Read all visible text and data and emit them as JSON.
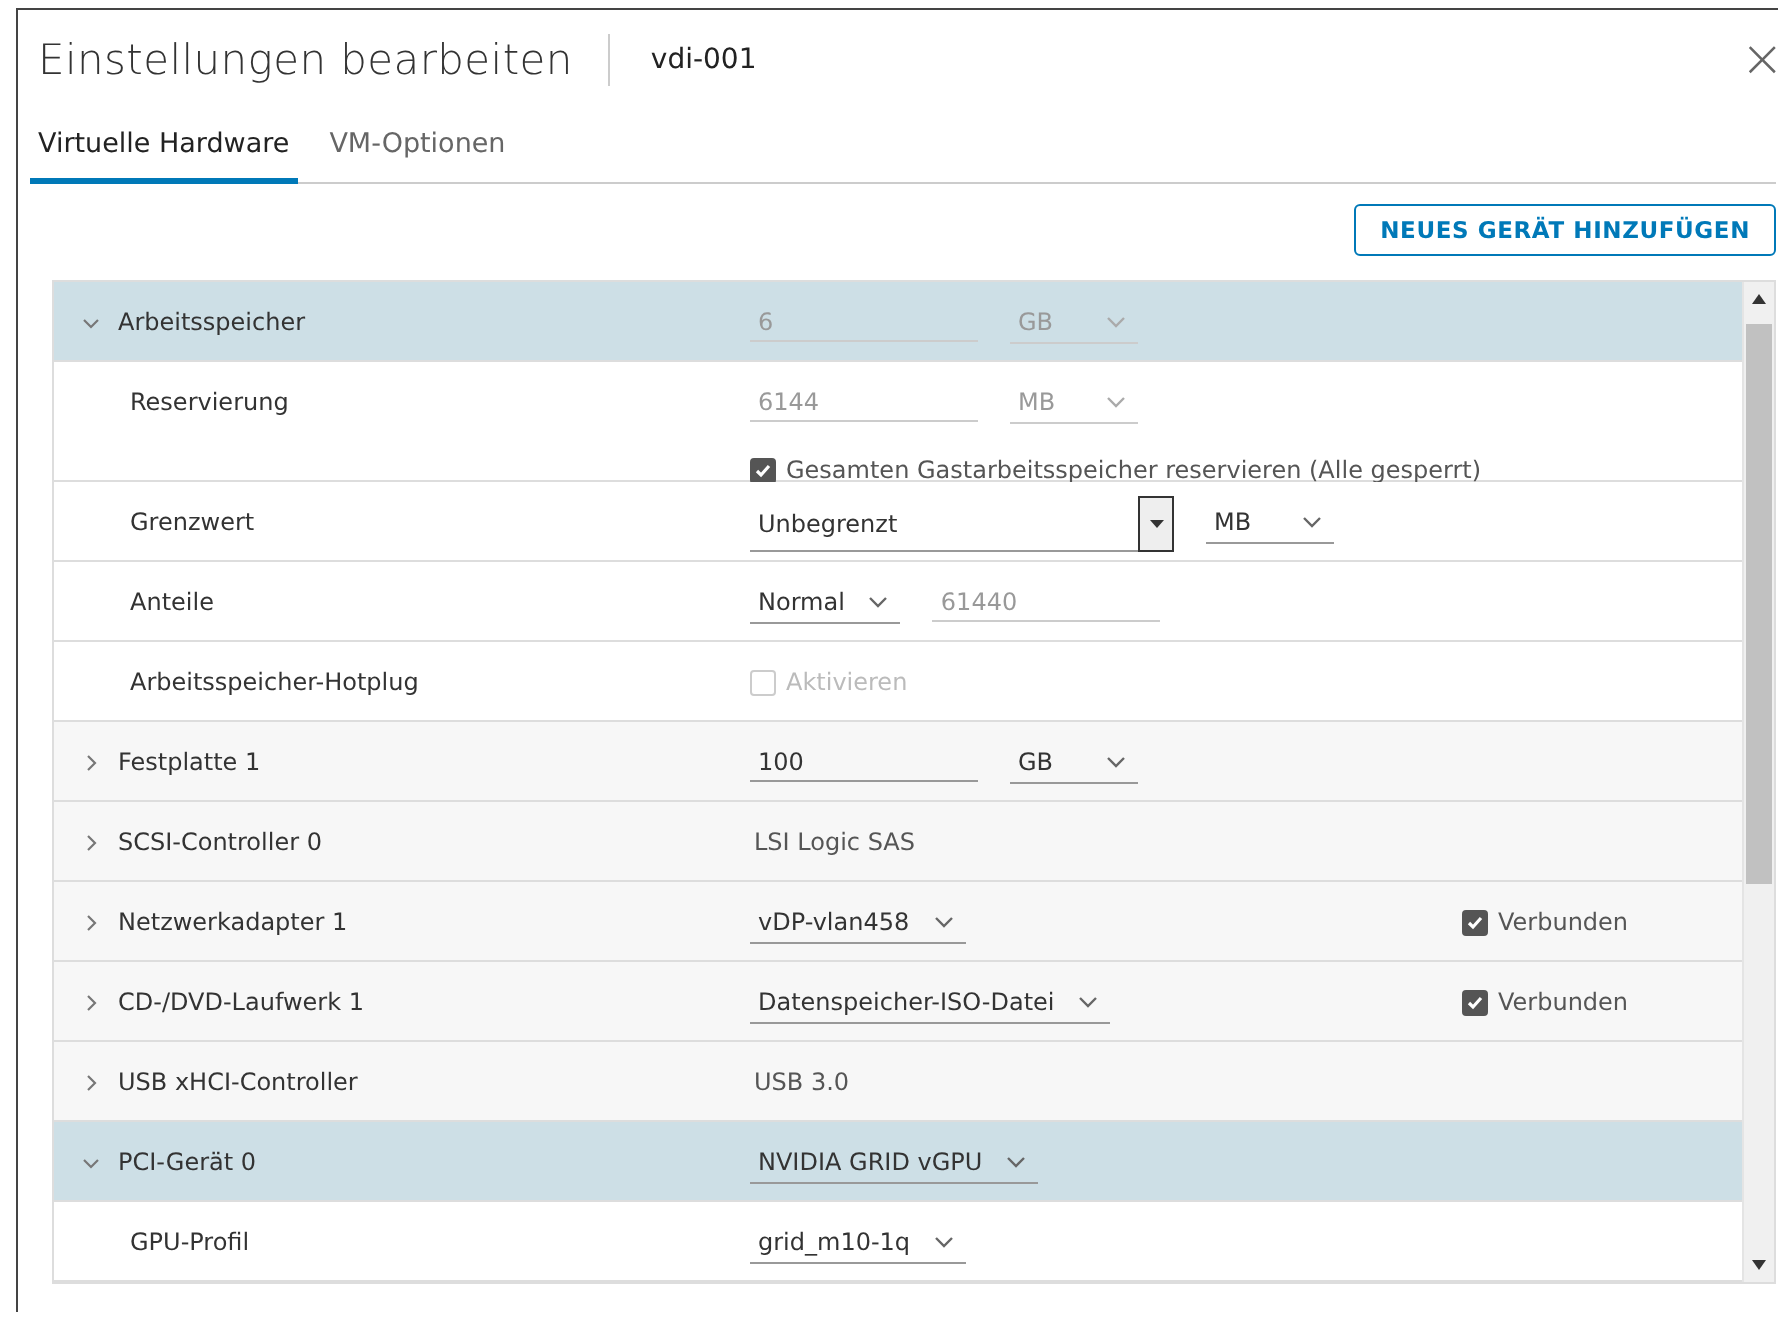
{
  "dialog": {
    "title": "Einstellungen bearbeiten",
    "subtitle": "vdi-001",
    "close": "×"
  },
  "tabs": [
    {
      "label": "Virtuelle Hardware",
      "selected": true
    },
    {
      "label": "VM-Optionen",
      "selected": false
    }
  ],
  "add_button": "NEUES GERÄT HINZUFÜGEN",
  "rows": [
    {
      "kind": "device",
      "label": "Arbeitsspeicher",
      "expanded": true,
      "selected": true,
      "controls": [
        {
          "kind": "input",
          "value": "6",
          "disabled": true
        },
        {
          "kind": "select",
          "value": "GB",
          "disabled": true
        }
      ]
    },
    {
      "kind": "sub",
      "label": "Reservierung",
      "controls": [
        {
          "kind": "input",
          "value": "6144",
          "disabled": true
        },
        {
          "kind": "select",
          "value": "MB",
          "disabled": true
        }
      ],
      "below": {
        "kind": "checkbox",
        "label": "Gesamten Gastarbeitsspeicher reservieren (Alle gesperrt)",
        "checked": true,
        "disabled": false
      }
    },
    {
      "kind": "sub",
      "label": "Grenzwert",
      "controls": [
        {
          "kind": "combo",
          "value": "Unbegrenzt"
        },
        {
          "kind": "select",
          "value": "MB",
          "disabled": false
        }
      ]
    },
    {
      "kind": "sub",
      "label": "Anteile",
      "controls": [
        {
          "kind": "select",
          "value": "Normal",
          "disabled": false
        },
        {
          "kind": "input",
          "value": "61440",
          "disabled": true
        }
      ]
    },
    {
      "kind": "sub",
      "label": "Arbeitsspeicher-Hotplug",
      "controls": [
        {
          "kind": "checkbox",
          "label": "Aktivieren",
          "checked": false,
          "disabled": true
        }
      ]
    },
    {
      "kind": "device",
      "label": "Festplatte 1",
      "expanded": false,
      "selected": false,
      "controls": [
        {
          "kind": "input",
          "value": "100",
          "disabled": false
        },
        {
          "kind": "select",
          "value": "GB",
          "disabled": false
        }
      ]
    },
    {
      "kind": "device",
      "label": "SCSI-Controller 0",
      "expanded": false,
      "selected": false,
      "controls": [
        {
          "kind": "text",
          "value": "LSI Logic SAS"
        }
      ]
    },
    {
      "kind": "device",
      "label": "Netzwerkadapter 1",
      "expanded": false,
      "selected": false,
      "controls": [
        {
          "kind": "select",
          "value": "vDP-vlan458",
          "disabled": false
        }
      ],
      "side": {
        "kind": "checkbox",
        "label": "Verbunden",
        "checked": true,
        "disabled": false
      }
    },
    {
      "kind": "device",
      "label": "CD-/DVD-Laufwerk 1",
      "expanded": false,
      "selected": false,
      "controls": [
        {
          "kind": "select",
          "value": "Datenspeicher-ISO-Datei",
          "disabled": false
        }
      ],
      "side": {
        "kind": "checkbox",
        "label": "Verbunden",
        "checked": true,
        "disabled": false
      }
    },
    {
      "kind": "device",
      "label": "USB xHCI-Controller",
      "expanded": false,
      "selected": false,
      "controls": [
        {
          "kind": "text",
          "value": "USB 3.0"
        }
      ]
    },
    {
      "kind": "device",
      "label": "PCI-Gerät 0",
      "expanded": true,
      "selected": true,
      "controls": [
        {
          "kind": "select",
          "value": "NVIDIA GRID vGPU",
          "disabled": false
        }
      ]
    },
    {
      "kind": "sub",
      "label": "GPU-Profil",
      "controls": [
        {
          "kind": "select",
          "value": "grid_m10-1q",
          "disabled": false
        }
      ]
    }
  ]
}
